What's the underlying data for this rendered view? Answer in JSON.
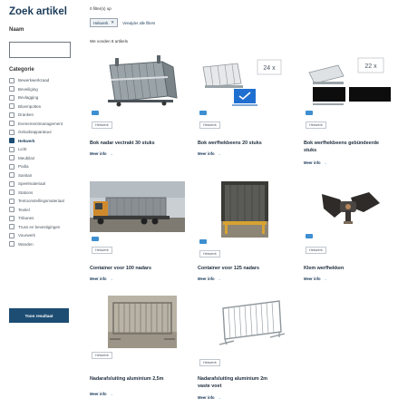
{
  "sidebar": {
    "title": "Zoek artikel",
    "name_label": "Naam",
    "name_input_value": "",
    "category_label": "Categorie",
    "categories": [
      {
        "label": "Bewerkwerkzaad",
        "checked": false
      },
      {
        "label": "Beveiliging",
        "checked": false
      },
      {
        "label": "Bevlagging",
        "checked": false
      },
      {
        "label": "Bloempotten",
        "checked": false
      },
      {
        "label": "Dranken",
        "checked": false
      },
      {
        "label": "Evenementmanagement",
        "checked": false
      },
      {
        "label": "Geluidsapparatuur",
        "checked": false
      },
      {
        "label": "Hekwerk",
        "checked": true
      },
      {
        "label": "Licht",
        "checked": false
      },
      {
        "label": "Meubilair",
        "checked": false
      },
      {
        "label": "Podia",
        "checked": false
      },
      {
        "label": "Sanitair",
        "checked": false
      },
      {
        "label": "Speelmateriaal",
        "checked": false
      },
      {
        "label": "Stations",
        "checked": false
      },
      {
        "label": "Tentoonstellingsmateriaal",
        "checked": false
      },
      {
        "label": "Textiel",
        "checked": false
      },
      {
        "label": "Tribunes",
        "checked": false
      },
      {
        "label": "Truss en bevestigingen",
        "checked": false
      },
      {
        "label": "Vuurwerk",
        "checked": false
      },
      {
        "label": "Wanden",
        "checked": false
      }
    ],
    "submit_label": "Toon resultaat"
  },
  "filters": {
    "heading": "0 filter(s) op",
    "active_chip": "Hekwerk",
    "clear_label": "Verwijder alle filters"
  },
  "results": {
    "count_label": "We vonden 8 artikels",
    "more_label": "Meer info",
    "items": [
      {
        "title_lines": [
          "Bok nadar vectrakt 30 stuks"
        ],
        "tag": "Hekwerk",
        "overlay": ""
      },
      {
        "title_lines": [
          "Bok werfhekbeens 20 stuks"
        ],
        "tag": "Hekwerk",
        "overlay": "24 x"
      },
      {
        "title_lines": [
          "Bok werfhekbeens gebündeerde",
          "stuks"
        ],
        "tag": "Hekwerk",
        "overlay": "22 x"
      },
      {
        "title_lines": [
          "Container voor 100 nadars"
        ],
        "tag": "Hekwerk",
        "overlay": ""
      },
      {
        "title_lines": [
          "Container voor 125 nadars"
        ],
        "tag": "Hekwerk",
        "overlay": ""
      },
      {
        "title_lines": [
          "Klem werfhekken"
        ],
        "tag": "Hekwerk",
        "overlay": ""
      },
      {
        "title_lines": [
          "Nadarafsluiting aluminium 2,5m"
        ],
        "tag": "Hekwerk",
        "overlay": ""
      },
      {
        "title_lines": [
          "Nadarafsluiting aluminium 2m",
          "vaste voet"
        ],
        "tag": "Hekwerk",
        "overlay": ""
      }
    ]
  },
  "colors": {
    "primary": "#1d4d73",
    "accent": "#3d8fd1",
    "heading": "#1b3b5a"
  }
}
